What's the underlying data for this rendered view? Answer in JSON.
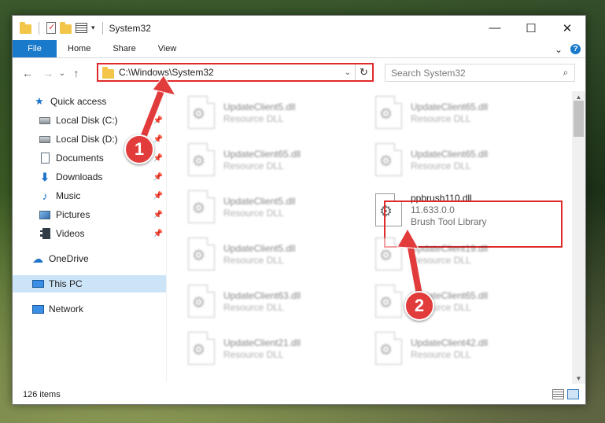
{
  "window": {
    "title": "System32",
    "controls": {
      "minimize": "—",
      "maximize": "☐",
      "close": "✕"
    }
  },
  "ribbon": {
    "tabs": [
      "File",
      "Home",
      "Share",
      "View"
    ],
    "expand_glyph": "⌄",
    "help_glyph": "?"
  },
  "nav": {
    "back": "←",
    "forward": "→",
    "recent": "⌄",
    "up": "↑"
  },
  "address": {
    "path": "C:\\Windows\\System32",
    "dropdown": "⌄",
    "refresh": "↻"
  },
  "search": {
    "placeholder": "Search System32",
    "icon": "⌕"
  },
  "sidebar": {
    "items": [
      {
        "label": "Quick access",
        "icon": "star-icon"
      },
      {
        "label": "Local Disk (C:)",
        "icon": "disk-icon",
        "pinned": true
      },
      {
        "label": "Local Disk (D:)",
        "icon": "disk-icon",
        "pinned": true
      },
      {
        "label": "Documents",
        "icon": "document-icon",
        "pinned": true
      },
      {
        "label": "Downloads",
        "icon": "download-icon",
        "pinned": true
      },
      {
        "label": "Music",
        "icon": "music-icon",
        "pinned": true
      },
      {
        "label": "Pictures",
        "icon": "pictures-icon",
        "pinned": true
      },
      {
        "label": "Videos",
        "icon": "videos-icon",
        "pinned": true
      },
      {
        "label": "OneDrive",
        "icon": "cloud-icon"
      },
      {
        "label": "This PC",
        "icon": "computer-icon",
        "selected": true
      },
      {
        "label": "Network",
        "icon": "network-icon"
      }
    ],
    "pin_glyph": "📌"
  },
  "files": [
    {
      "name": "UpdateClient5.dll",
      "type": "Resource DLL",
      "blurred": true
    },
    {
      "name": "UpdateClient65.dll",
      "type": "Resource DLL",
      "blurred": true
    },
    {
      "name": "UpdateClient65.dll",
      "type": "Resource DLL",
      "blurred": true
    },
    {
      "name": "UpdateClient65.dll",
      "type": "Resource DLL",
      "blurred": true
    },
    {
      "name": "UpdateClient5.dll",
      "type": "Resource DLL",
      "blurred": true
    },
    {
      "name": "ppbrush110.dll",
      "version": "11.633.0.0",
      "type": "Brush Tool Library",
      "blurred": false,
      "highlighted": true
    },
    {
      "name": "UpdateClient5.dll",
      "type": "Resource DLL",
      "blurred": true
    },
    {
      "name": "UpdateClient19.dll",
      "type": "Resource DLL",
      "blurred": true
    },
    {
      "name": "UpdateClient63.dll",
      "type": "Resource DLL",
      "blurred": true
    },
    {
      "name": "UpdateClient65.dll",
      "type": "Resource DLL",
      "blurred": true
    },
    {
      "name": "UpdateClient21.dll",
      "type": "Resource DLL",
      "blurred": true
    },
    {
      "name": "UpdateClient42.dll",
      "type": "Resource DLL",
      "blurred": true
    }
  ],
  "status": {
    "item_count": "126 items"
  },
  "annotations": {
    "step1": "1",
    "step2": "2",
    "color": "#e23b3b"
  }
}
